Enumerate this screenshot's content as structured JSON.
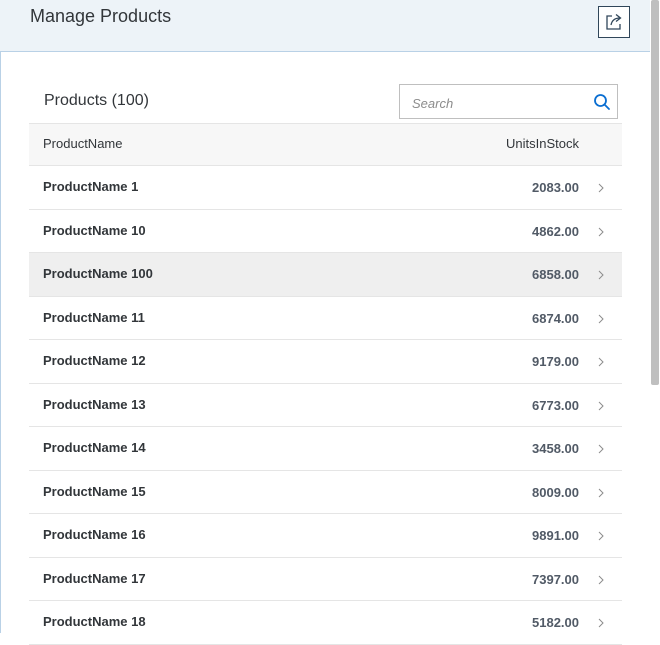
{
  "header": {
    "title": "Manage Products",
    "share_icon": "share-icon"
  },
  "toolbar": {
    "title": "Products (100)"
  },
  "search": {
    "placeholder": "Search",
    "icon": "search-icon"
  },
  "table": {
    "columns": {
      "name": "ProductName",
      "units": "UnitsInStock"
    },
    "rows": [
      {
        "name": "ProductName 1",
        "units": "2083.00"
      },
      {
        "name": "ProductName 10",
        "units": "4862.00"
      },
      {
        "name": "ProductName 100",
        "units": "6858.00"
      },
      {
        "name": "ProductName 11",
        "units": "6874.00"
      },
      {
        "name": "ProductName 12",
        "units": "9179.00"
      },
      {
        "name": "ProductName 13",
        "units": "6773.00"
      },
      {
        "name": "ProductName 14",
        "units": "3458.00"
      },
      {
        "name": "ProductName 15",
        "units": "8009.00"
      },
      {
        "name": "ProductName 16",
        "units": "9891.00"
      },
      {
        "name": "ProductName 17",
        "units": "7397.00"
      },
      {
        "name": "ProductName 18",
        "units": "5182.00"
      }
    ],
    "highlighted_row": 2
  },
  "colors": {
    "header_bg": "#edf3f8",
    "header_border": "#b9d1e6",
    "icon_blue": "#0a6ed1",
    "text": "#32363a"
  }
}
